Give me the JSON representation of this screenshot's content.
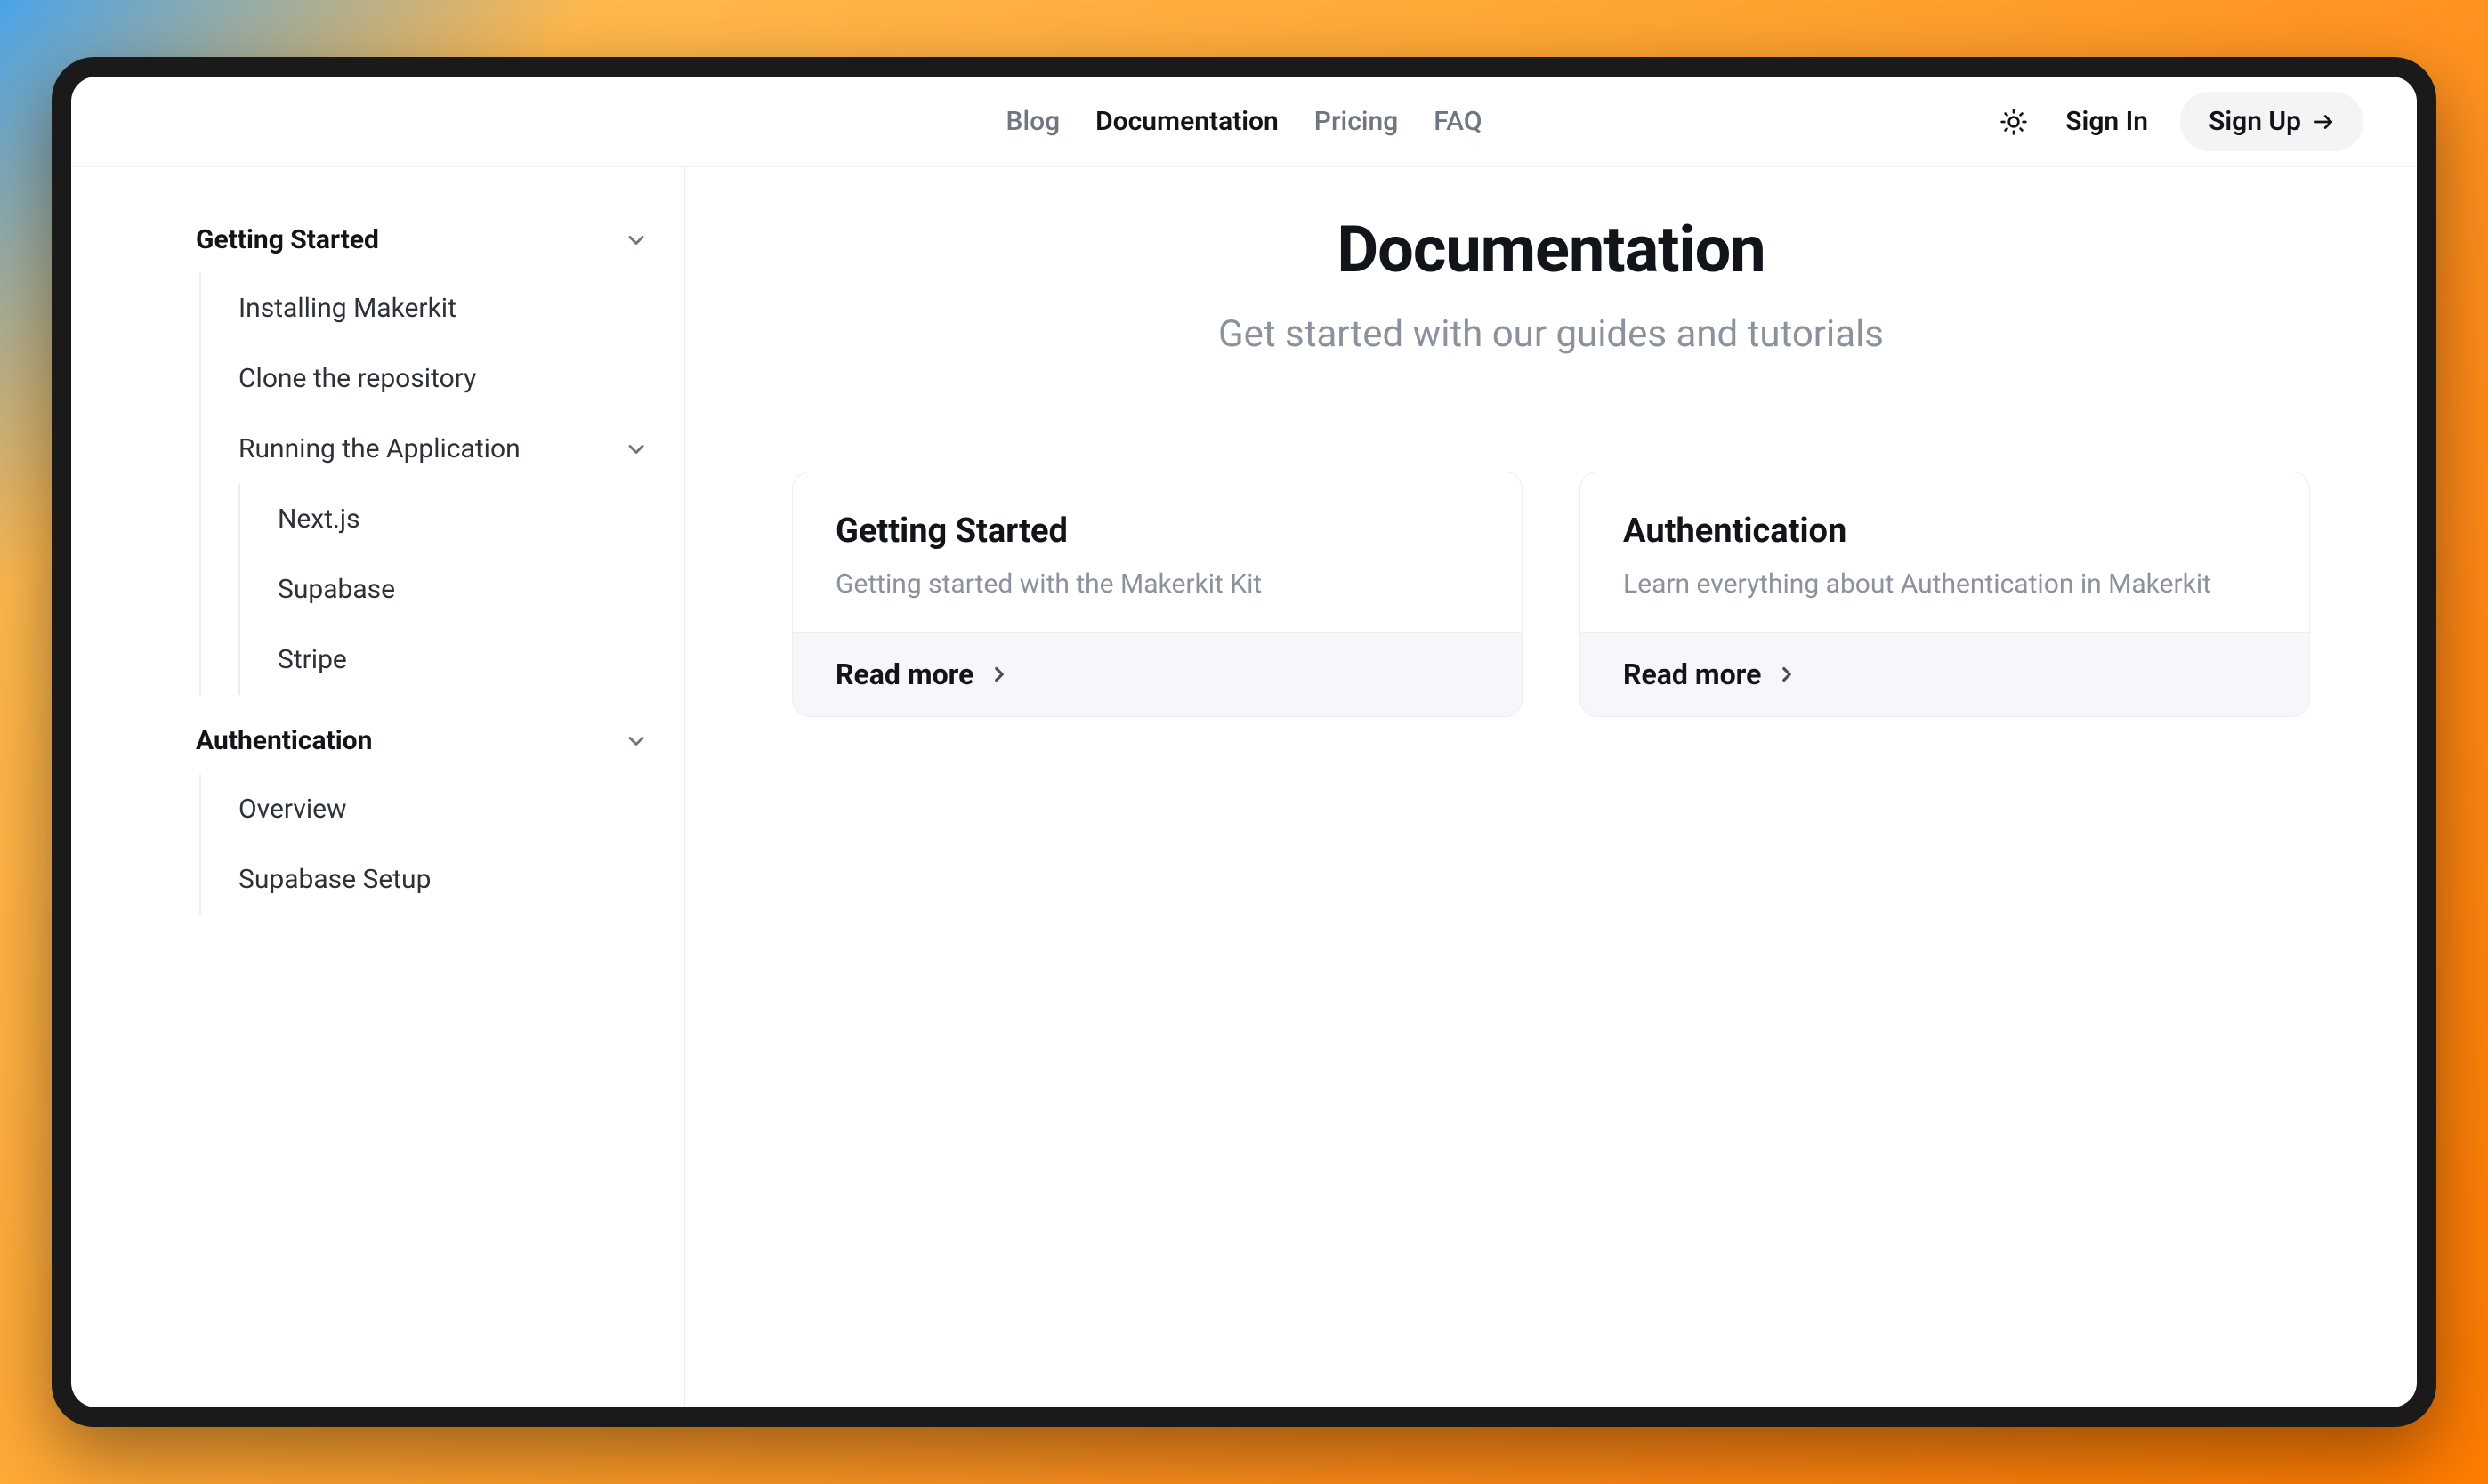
{
  "nav": {
    "links": [
      {
        "label": "Blog",
        "active": false
      },
      {
        "label": "Documentation",
        "active": true
      },
      {
        "label": "Pricing",
        "active": false
      },
      {
        "label": "FAQ",
        "active": false
      }
    ],
    "sign_in": "Sign In",
    "sign_up": "Sign Up"
  },
  "sidebar": {
    "sections": [
      {
        "title": "Getting Started",
        "items": [
          {
            "label": "Installing Makerkit"
          },
          {
            "label": "Clone the repository"
          },
          {
            "label": "Running the Application",
            "expandable": true,
            "children": [
              {
                "label": "Next.js"
              },
              {
                "label": "Supabase"
              },
              {
                "label": "Stripe"
              }
            ]
          }
        ]
      },
      {
        "title": "Authentication",
        "items": [
          {
            "label": "Overview"
          },
          {
            "label": "Supabase Setup"
          }
        ]
      }
    ]
  },
  "main": {
    "title": "Documentation",
    "subtitle": "Get started with our guides and tutorials",
    "cards": [
      {
        "title": "Getting Started",
        "description": "Getting started with the Makerkit Kit",
        "cta": "Read more"
      },
      {
        "title": "Authentication",
        "description": "Learn everything about Authentication in Makerkit",
        "cta": "Read more"
      }
    ]
  }
}
